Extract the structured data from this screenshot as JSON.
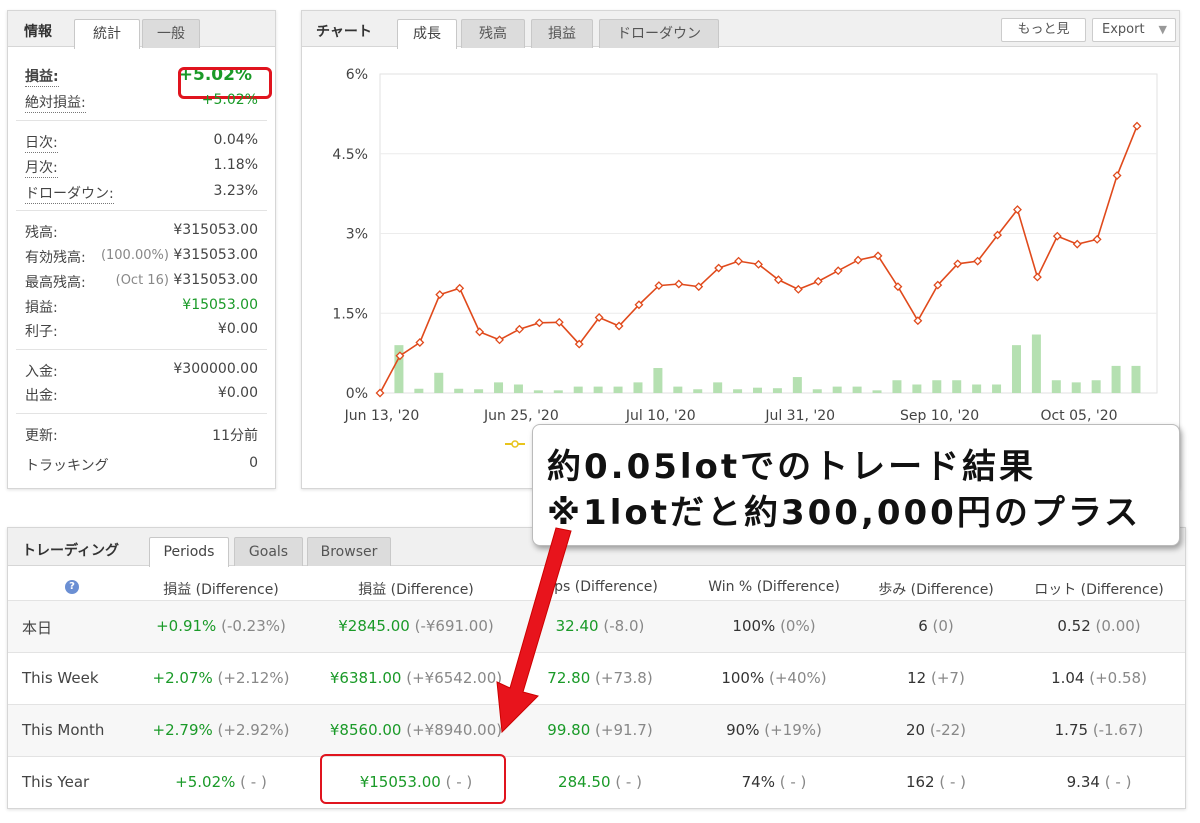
{
  "info_panel": {
    "title": "情報",
    "tabs": [
      {
        "label": "統計"
      },
      {
        "label": "一般"
      }
    ],
    "stats": {
      "profit_loss": {
        "label": "損益:",
        "value": "+5.02%"
      },
      "abs_profit": {
        "label": "絶対損益:",
        "value": "+5.02%"
      },
      "daily": {
        "label": "日次:",
        "value": "0.04%"
      },
      "monthly": {
        "label": "月次:",
        "value": "1.18%"
      },
      "drawdown": {
        "label": "ドローダウン:",
        "value": "3.23%"
      },
      "balance": {
        "label": "残高:",
        "value": "¥315053.00"
      },
      "equity": {
        "label": "有効残高:",
        "note": "(100.00%)",
        "value": "¥315053.00"
      },
      "highest": {
        "label": "最高残高:",
        "note": "(Oct 16)",
        "value": "¥315053.00"
      },
      "profit": {
        "label": "損益:",
        "value": "¥15053.00"
      },
      "interest": {
        "label": "利子:",
        "value": "¥0.00"
      },
      "deposits": {
        "label": "入金:",
        "value": "¥300000.00"
      },
      "withdrawals": {
        "label": "出金:",
        "value": "¥0.00"
      },
      "updated": {
        "label": "更新:",
        "value": "11分前"
      },
      "tracking": {
        "label": "トラッキング",
        "value": "0"
      }
    }
  },
  "chart_panel": {
    "title": "チャート",
    "tabs": [
      {
        "label": "成長"
      },
      {
        "label": "残高"
      },
      {
        "label": "損益"
      },
      {
        "label": "ドローダウン"
      }
    ],
    "more_button": "もっと見",
    "export_button": "Export"
  },
  "chart_data": {
    "type": "line",
    "y_ticks": [
      "6%",
      "4.5%",
      "3%",
      "1.5%",
      "0%"
    ],
    "ylim": [
      0,
      6
    ],
    "x_ticks": [
      "Jun 13, '20",
      "Jun 25, '20",
      "Jul 10, '20",
      "Jul 31, '20",
      "Sep 10, '20",
      "Oct 05, '20"
    ],
    "series": [
      {
        "values": [
          0.0,
          0.7,
          0.95,
          1.85,
          1.97,
          1.15,
          1.0,
          1.2,
          1.32,
          1.33,
          0.92,
          1.42,
          1.26,
          1.66,
          2.02,
          2.05,
          2.0,
          2.35,
          2.48,
          2.42,
          2.13,
          1.95,
          2.1,
          2.3,
          2.5,
          2.58,
          2.0,
          1.36,
          2.03,
          2.43,
          2.48,
          2.97,
          3.45,
          2.18,
          2.95,
          2.8,
          2.89,
          4.09,
          5.02
        ]
      },
      {
        "values": [
          0.9,
          0.08,
          0.38,
          0.08,
          0.07,
          0.2,
          0.16,
          0.05,
          0.05,
          0.12,
          0.12,
          0.12,
          0.2,
          0.47,
          0.12,
          0.07,
          0.2,
          0.07,
          0.1,
          0.09,
          0.3,
          0.07,
          0.12,
          0.12,
          0.05,
          0.24,
          0.16,
          0.24,
          0.24,
          0.16,
          0.16,
          0.9,
          1.1,
          0.24,
          0.2,
          0.24,
          0.51,
          0.51
        ]
      }
    ]
  },
  "annotation": {
    "line1": "約0.05lotでのトレード結果",
    "line2": "※1lotだと約300,000円のプラス"
  },
  "trading_panel": {
    "title": "トレーディング",
    "tabs": [
      {
        "label": "Periods"
      },
      {
        "label": "Goals"
      },
      {
        "label": "Browser"
      }
    ],
    "help_icon": "?",
    "columns": [
      "損益 (Difference)",
      "損益 (Difference)",
      "Pips (Difference)",
      "Win % (Difference)",
      "歩み (Difference)",
      "ロット (Difference)"
    ],
    "rows": [
      {
        "period": "本日",
        "pct": "+0.91%",
        "pct_diff": "(-0.23%)",
        "yen": "¥2845.00",
        "yen_diff": "(-¥691.00)",
        "pips": "32.40",
        "pips_diff": "(-8.0)",
        "win": "100%",
        "win_diff": "(0%)",
        "trades": "6",
        "trades_diff": "(0)",
        "lots": "0.52",
        "lots_diff": "(0.00)"
      },
      {
        "period": "This Week",
        "pct": "+2.07%",
        "pct_diff": "(+2.12%)",
        "yen": "¥6381.00",
        "yen_diff": "(+¥6542.00)",
        "pips": "72.80",
        "pips_diff": "(+73.8)",
        "win": "100%",
        "win_diff": "(+40%)",
        "trades": "12",
        "trades_diff": "(+7)",
        "lots": "1.04",
        "lots_diff": "(+0.58)"
      },
      {
        "period": "This Month",
        "pct": "+2.79%",
        "pct_diff": "(+2.92%)",
        "yen": "¥8560.00",
        "yen_diff": "(+¥8940.00)",
        "pips": "99.80",
        "pips_diff": "(+91.7)",
        "win": "90%",
        "win_diff": "(+19%)",
        "trades": "20",
        "trades_diff": "(-22)",
        "lots": "1.75",
        "lots_diff": "(-1.67)"
      },
      {
        "period": "This Year",
        "pct": "+5.02%",
        "pct_diff": "( - )",
        "yen": "¥15053.00",
        "yen_diff": "( - )",
        "pips": "284.50",
        "pips_diff": "( - )",
        "win": "74%",
        "win_diff": "( - )",
        "trades": "162",
        "trades_diff": "( - )",
        "lots": "9.34",
        "lots_diff": "( - )"
      }
    ]
  },
  "colors": {
    "profit_green": "#1a9a28",
    "line_red": "#e04a1c",
    "bar_green": "#b5e0b1",
    "highlight_red": "#e0141e"
  }
}
